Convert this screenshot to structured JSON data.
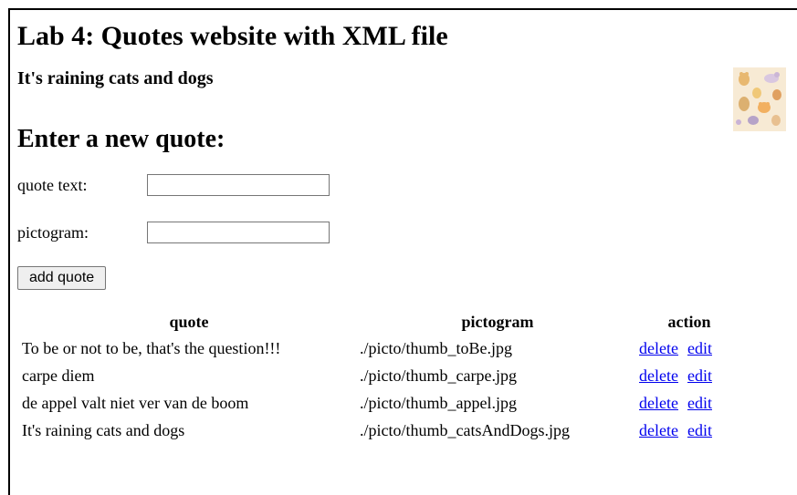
{
  "page": {
    "title": "Lab 4: Quotes website with XML file",
    "current_quote": "It's raining cats and dogs",
    "pictogram_icon": "cats-and-dogs-picture-icon"
  },
  "form": {
    "heading": "Enter a new quote:",
    "quote_text_label": "quote text:",
    "quote_text_value": "",
    "pictogram_label": "pictogram:",
    "pictogram_value": "",
    "submit_label": "add quote"
  },
  "table": {
    "headers": [
      "quote",
      "pictogram",
      "action"
    ],
    "rows": [
      {
        "quote": "To be or not to be, that's the question!!!",
        "pictogram": "./picto/thumb_toBe.jpg",
        "delete": "delete",
        "edit": "edit"
      },
      {
        "quote": "carpe diem",
        "pictogram": "./picto/thumb_carpe.jpg",
        "delete": "delete",
        "edit": "edit"
      },
      {
        "quote": "de appel valt niet ver van de boom",
        "pictogram": "./picto/thumb_appel.jpg",
        "delete": "delete",
        "edit": "edit"
      },
      {
        "quote": "It's raining cats and dogs",
        "pictogram": "./picto/thumb_catsAndDogs.jpg",
        "delete": "delete",
        "edit": "edit"
      }
    ]
  },
  "colors": {
    "link": "#0000ee",
    "button_bg": "#efefef",
    "picture_bg": "#f7ead4"
  }
}
